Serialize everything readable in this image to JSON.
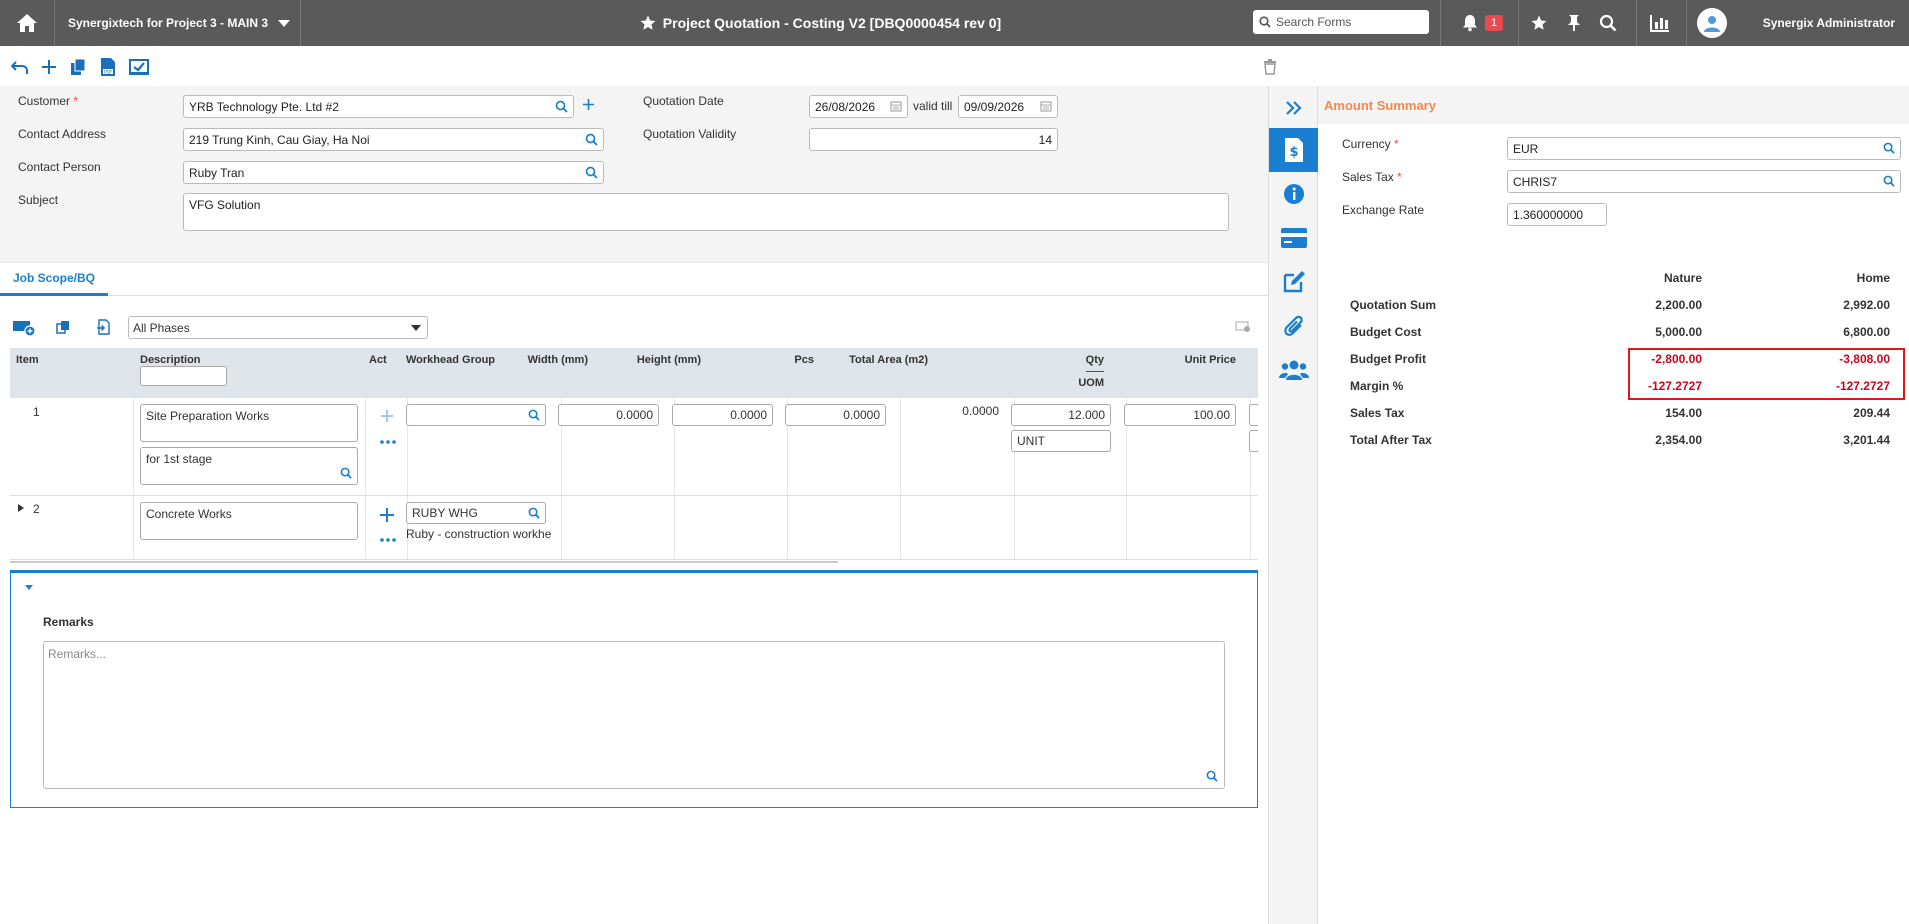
{
  "topbar": {
    "project": "Synergixtech for Project 3 - MAIN 3",
    "title": "Project Quotation - Costing V2 [DBQ0000454 rev 0]",
    "search_placeholder": "Search Forms",
    "notification_count": "1",
    "user_name": "Synergix Administrator"
  },
  "form": {
    "customer_label": "Customer",
    "customer_value": "YRB Technology Pte. Ltd #2",
    "contact_address_label": "Contact Address",
    "contact_address_value": "219 Trung Kinh, Cau Giay, Ha Noi",
    "contact_person_label": "Contact Person",
    "contact_person_value": "Ruby Tran",
    "subject_label": "Subject",
    "subject_value": "VFG Solution",
    "quotation_date_label": "Quotation Date",
    "quotation_date_value": "26/08/2026",
    "valid_till_label": "valid till",
    "valid_till_value": "09/09/2026",
    "quotation_validity_label": "Quotation Validity",
    "quotation_validity_value": "14"
  },
  "tabs": {
    "job_scope": "Job Scope/BQ"
  },
  "grid": {
    "phase_select": "All Phases",
    "headers": {
      "item": "Item",
      "description": "Description",
      "act": "Act",
      "workhead_group": "Workhead Group",
      "width": "Width (mm)",
      "height": "Height (mm)",
      "pcs": "Pcs",
      "total_area": "Total Area (m2)",
      "qty": "Qty",
      "uom": "UOM",
      "unit_price": "Unit Price"
    },
    "rows": [
      {
        "item": "1",
        "description": "Site Preparation Works",
        "sub_description": "for 1st stage",
        "workhead": "",
        "width": "0.0000",
        "height": "0.0000",
        "pcs": "0.0000",
        "total_area": "0.0000",
        "qty": "12.000",
        "uom": "UNIT",
        "unit_price": "100.00"
      },
      {
        "item": "2",
        "description": "Concrete Works",
        "workhead": "RUBY WHG",
        "workhead_desc": "Ruby - construction workhe"
      }
    ]
  },
  "remarks": {
    "title": "Remarks",
    "placeholder": "Remarks..."
  },
  "summary": {
    "title": "Amount Summary",
    "currency_label": "Currency",
    "currency_value": "EUR",
    "sales_tax_label": "Sales Tax",
    "sales_tax_value": "CHRIS7",
    "exchange_rate_label": "Exchange Rate",
    "exchange_rate_value": "1.360000000",
    "col_nature": "Nature",
    "col_home": "Home",
    "rows": [
      {
        "label": "Quotation Sum",
        "nature": "2,200.00",
        "home": "2,992.00"
      },
      {
        "label": "Budget Cost",
        "nature": "5,000.00",
        "home": "6,800.00"
      },
      {
        "label": "Budget Profit",
        "nature": "-2,800.00",
        "home": "-3,808.00"
      },
      {
        "label": "Margin %",
        "nature": "-127.2727",
        "home": "-127.2727"
      },
      {
        "label": "Sales Tax",
        "nature": "154.00",
        "home": "209.44"
      },
      {
        "label": "Total After Tax",
        "nature": "2,354.00",
        "home": "3,201.44"
      }
    ]
  },
  "colors": {
    "topbar": "#5a5a5a",
    "accent": "#1a7fd0",
    "negative": "#d0021b",
    "summary_title": "#f08a4b",
    "highlight_box": "#e0161b"
  }
}
